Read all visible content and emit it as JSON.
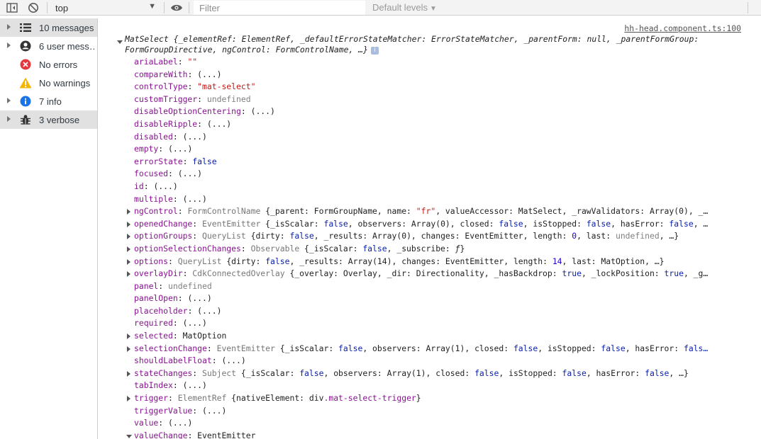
{
  "toolbar": {
    "context": "top",
    "filter_placeholder": "Filter",
    "levels": "Default levels"
  },
  "sidebar": {
    "items": [
      {
        "label": "10 messages",
        "icon": "list-icon"
      },
      {
        "label": "6 user mess…",
        "icon": "user-icon"
      },
      {
        "label": "No errors",
        "icon": "error-icon"
      },
      {
        "label": "No warnings",
        "icon": "warning-icon"
      },
      {
        "label": "7 info",
        "icon": "info-icon"
      },
      {
        "label": "3 verbose",
        "icon": "bug-icon"
      }
    ]
  },
  "console": {
    "source": "hh-head.component.ts:100",
    "header": "MatSelect {_elementRef: ElementRef, _defaultErrorStateMatcher: ErrorStateMatcher, _parentForm: null, _parentFormGroup: FormGroupDirective, ngControl: FormControlName, …}",
    "info_badge": "i",
    "props": [
      {
        "key": "ariaLabel",
        "parts": [
          {
            "t": "\"\"",
            "c": "str"
          }
        ]
      },
      {
        "key": "compareWith",
        "parts": [
          {
            "t": "(...)",
            "c": "plain"
          }
        ]
      },
      {
        "key": "controlType",
        "parts": [
          {
            "t": "\"mat-select\"",
            "c": "str"
          }
        ]
      },
      {
        "key": "customTrigger",
        "parts": [
          {
            "t": "undefined",
            "c": "undef"
          }
        ]
      },
      {
        "key": "disableOptionCentering",
        "parts": [
          {
            "t": "(...)",
            "c": "plain"
          }
        ]
      },
      {
        "key": "disableRipple",
        "parts": [
          {
            "t": "(...)",
            "c": "plain"
          }
        ]
      },
      {
        "key": "disabled",
        "parts": [
          {
            "t": "(...)",
            "c": "plain"
          }
        ]
      },
      {
        "key": "empty",
        "parts": [
          {
            "t": "(...)",
            "c": "plain"
          }
        ]
      },
      {
        "key": "errorState",
        "parts": [
          {
            "t": "false",
            "c": "kw"
          }
        ]
      },
      {
        "key": "focused",
        "parts": [
          {
            "t": "(...)",
            "c": "plain"
          }
        ]
      },
      {
        "key": "id",
        "parts": [
          {
            "t": "(...)",
            "c": "plain"
          }
        ]
      },
      {
        "key": "multiple",
        "parts": [
          {
            "t": "(...)",
            "c": "plain"
          }
        ]
      },
      {
        "key": "ngControl",
        "expand": "closed",
        "parts": [
          {
            "t": "FormControlName ",
            "c": "cls"
          },
          {
            "t": "{_parent: FormGroupName, name: ",
            "c": "plain"
          },
          {
            "t": "\"fr\"",
            "c": "str"
          },
          {
            "t": ", valueAccessor: MatSelect, _rawValidators: Array(0), _…",
            "c": "plain"
          }
        ]
      },
      {
        "key": "openedChange",
        "expand": "closed",
        "parts": [
          {
            "t": "EventEmitter ",
            "c": "cls"
          },
          {
            "t": "{_isScalar: ",
            "c": "plain"
          },
          {
            "t": "false",
            "c": "kw"
          },
          {
            "t": ", observers: Array(0), closed: ",
            "c": "plain"
          },
          {
            "t": "false",
            "c": "kw"
          },
          {
            "t": ", isStopped: ",
            "c": "plain"
          },
          {
            "t": "false",
            "c": "kw"
          },
          {
            "t": ", hasError: ",
            "c": "plain"
          },
          {
            "t": "false",
            "c": "kw"
          },
          {
            "t": ", …",
            "c": "plain"
          }
        ]
      },
      {
        "key": "optionGroups",
        "expand": "closed",
        "parts": [
          {
            "t": "QueryList ",
            "c": "cls"
          },
          {
            "t": "{dirty: ",
            "c": "plain"
          },
          {
            "t": "false",
            "c": "kw"
          },
          {
            "t": ", _results: Array(0), changes: EventEmitter, length: ",
            "c": "plain"
          },
          {
            "t": "0",
            "c": "num"
          },
          {
            "t": ", last: ",
            "c": "plain"
          },
          {
            "t": "undefined",
            "c": "undef"
          },
          {
            "t": ", …}",
            "c": "plain"
          }
        ]
      },
      {
        "key": "optionSelectionChanges",
        "expand": "closed",
        "parts": [
          {
            "t": "Observable ",
            "c": "cls"
          },
          {
            "t": "{_isScalar: ",
            "c": "plain"
          },
          {
            "t": "false",
            "c": "kw"
          },
          {
            "t": ", _subscribe: ",
            "c": "plain"
          },
          {
            "t": "ƒ",
            "c": "fn"
          },
          {
            "t": "}",
            "c": "plain"
          }
        ]
      },
      {
        "key": "options",
        "expand": "closed",
        "parts": [
          {
            "t": "QueryList ",
            "c": "cls"
          },
          {
            "t": "{dirty: ",
            "c": "plain"
          },
          {
            "t": "false",
            "c": "kw"
          },
          {
            "t": ", _results: Array(14), changes: EventEmitter, length: ",
            "c": "plain"
          },
          {
            "t": "14",
            "c": "num"
          },
          {
            "t": ", last: MatOption, …}",
            "c": "plain"
          }
        ]
      },
      {
        "key": "overlayDir",
        "expand": "closed",
        "parts": [
          {
            "t": "CdkConnectedOverlay ",
            "c": "cls"
          },
          {
            "t": "{_overlay: Overlay, _dir: Directionality, _hasBackdrop: ",
            "c": "plain"
          },
          {
            "t": "true",
            "c": "kw"
          },
          {
            "t": ", _lockPosition: ",
            "c": "plain"
          },
          {
            "t": "true",
            "c": "kw"
          },
          {
            "t": ", _g…",
            "c": "plain"
          }
        ]
      },
      {
        "key": "panel",
        "parts": [
          {
            "t": "undefined",
            "c": "undef"
          }
        ]
      },
      {
        "key": "panelOpen",
        "parts": [
          {
            "t": "(...)",
            "c": "plain"
          }
        ]
      },
      {
        "key": "placeholder",
        "parts": [
          {
            "t": "(...)",
            "c": "plain"
          }
        ]
      },
      {
        "key": "required",
        "parts": [
          {
            "t": "(...)",
            "c": "plain"
          }
        ]
      },
      {
        "key": "selected",
        "expand": "closed",
        "parts": [
          {
            "t": "MatOption",
            "c": "plain"
          }
        ]
      },
      {
        "key": "selectionChange",
        "expand": "closed",
        "parts": [
          {
            "t": "EventEmitter ",
            "c": "cls"
          },
          {
            "t": "{_isScalar: ",
            "c": "plain"
          },
          {
            "t": "false",
            "c": "kw"
          },
          {
            "t": ", observers: Array(1), closed: ",
            "c": "plain"
          },
          {
            "t": "false",
            "c": "kw"
          },
          {
            "t": ", isStopped: ",
            "c": "plain"
          },
          {
            "t": "false",
            "c": "kw"
          },
          {
            "t": ", hasError: ",
            "c": "plain"
          },
          {
            "t": "fals…",
            "c": "kw"
          }
        ]
      },
      {
        "key": "shouldLabelFloat",
        "parts": [
          {
            "t": "(...)",
            "c": "plain"
          }
        ]
      },
      {
        "key": "stateChanges",
        "expand": "closed",
        "parts": [
          {
            "t": "Subject ",
            "c": "cls"
          },
          {
            "t": "{_isScalar: ",
            "c": "plain"
          },
          {
            "t": "false",
            "c": "kw"
          },
          {
            "t": ", observers: Array(1), closed: ",
            "c": "plain"
          },
          {
            "t": "false",
            "c": "kw"
          },
          {
            "t": ", isStopped: ",
            "c": "plain"
          },
          {
            "t": "false",
            "c": "kw"
          },
          {
            "t": ", hasError: ",
            "c": "plain"
          },
          {
            "t": "false",
            "c": "kw"
          },
          {
            "t": ", …}",
            "c": "plain"
          }
        ]
      },
      {
        "key": "tabIndex",
        "parts": [
          {
            "t": "(...)",
            "c": "plain"
          }
        ]
      },
      {
        "key": "trigger",
        "expand": "closed",
        "parts": [
          {
            "t": "ElementRef ",
            "c": "cls"
          },
          {
            "t": "{nativeElement: div",
            "c": "plain"
          },
          {
            "t": ".mat-select-trigger",
            "c": "pk"
          },
          {
            "t": "}",
            "c": "plain"
          }
        ]
      },
      {
        "key": "triggerValue",
        "parts": [
          {
            "t": "(...)",
            "c": "plain"
          }
        ]
      },
      {
        "key": "value",
        "parts": [
          {
            "t": "(...)",
            "c": "plain"
          }
        ]
      },
      {
        "key": "valueChange",
        "expand": "open",
        "parts": [
          {
            "t": "EventEmitter",
            "c": "plain"
          }
        ]
      }
    ]
  }
}
